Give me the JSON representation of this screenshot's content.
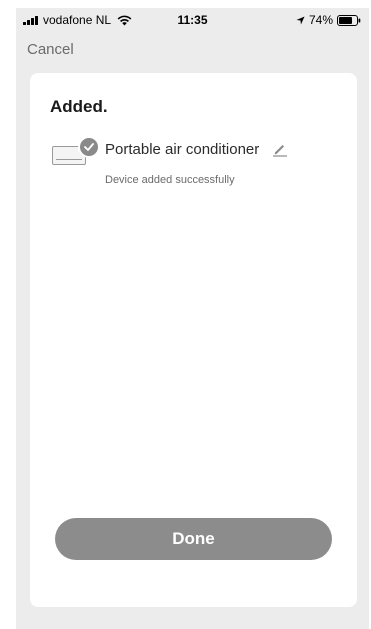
{
  "status_bar": {
    "carrier": "vodafone NL",
    "time": "11:35",
    "battery": "74%",
    "icons": [
      "signal-icon",
      "wifi-icon",
      "location-icon",
      "battery-icon"
    ]
  },
  "nav": {
    "cancel_label": "Cancel"
  },
  "card": {
    "title": "Added.",
    "device": {
      "name": "Portable air conditioner",
      "status": "Device added successfully",
      "icon": "air-conditioner-icon",
      "badge_icon": "check-icon",
      "edit_icon": "pencil-icon"
    },
    "done_label": "Done"
  },
  "colors": {
    "background": "#ececec",
    "card": "#ffffff",
    "button": "#8c8c8c",
    "muted_text": "#6b6b6b"
  }
}
